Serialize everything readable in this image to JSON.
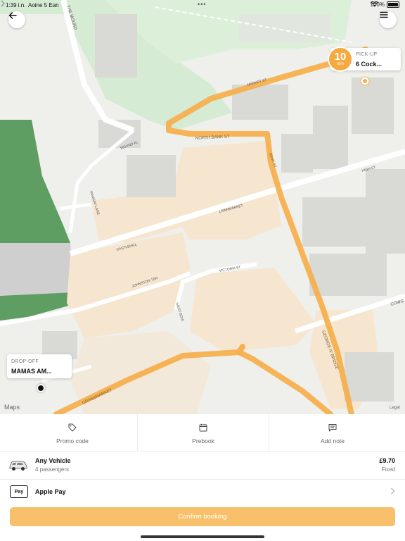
{
  "status_bar": {
    "time": "1:39 i.n.",
    "carrier": "Aoine 5 Ean",
    "dots": "•••",
    "battery": "100%"
  },
  "map": {
    "attribution": "Maps",
    "legal": "Legal",
    "streets": {
      "the_mound": "THE MOUND",
      "ramsay_lane": "RAMSAY LANE",
      "mound_pl": "MOUND PL",
      "north_bank_st": "NORTH BANK ST",
      "bank_st": "BANK ST",
      "high_st": "HIGH ST",
      "lawnmarket": "LAWNMARKET",
      "castlehill": "CASTLEHILL",
      "johnston_ter": "JOHNSTON TER",
      "victoria_st": "VICTORIA ST",
      "west_bow": "WEST BOW",
      "cowgate": "COWG",
      "george_iv_bridge": "GEORGE IV BRIDGE",
      "grassmarket": "GRASSMARKET",
      "market_st": "MARKET ST"
    },
    "colors": {
      "route": "#f5b04f",
      "park": "#5f9e63",
      "oldtown": "#f6e6cf"
    }
  },
  "pickup": {
    "eta_value": "10",
    "eta_unit": "min",
    "label": "PICK-UP",
    "address": "6 Cock..."
  },
  "dropoff": {
    "label": "DROP-OFF",
    "address": "MAMAS AM..."
  },
  "options": {
    "promo_label": "Promo code",
    "prebook_label": "Prebook",
    "note_label": "Add note"
  },
  "vehicle": {
    "name": "Any Vehicle",
    "passengers": "4 passengers",
    "price": "£9.70",
    "price_type": "Fixed"
  },
  "payment": {
    "badge": "Pay",
    "label": "Apple Pay"
  },
  "confirm_label": "Confirm booking",
  "accent_color": "#f8c06a"
}
